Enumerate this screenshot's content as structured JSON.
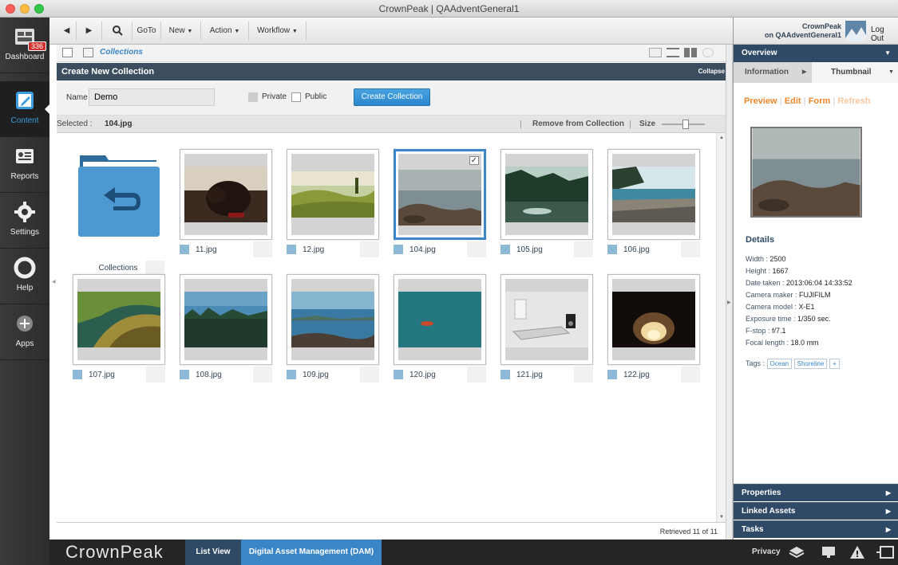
{
  "window": {
    "title": "CrownPeak | QAAdventGeneral1"
  },
  "leftnav": {
    "badge": "336",
    "items": [
      {
        "label": "Dashboard",
        "icon": "dashboard-icon"
      },
      {
        "label": "Content",
        "icon": "content-edit-icon"
      },
      {
        "label": "Reports",
        "icon": "reports-icon"
      },
      {
        "label": "Settings",
        "icon": "gear-icon"
      },
      {
        "label": "Help",
        "icon": "lifebuoy-icon"
      },
      {
        "label": "Apps",
        "icon": "plus-circle-icon"
      }
    ]
  },
  "toolbar": {
    "goto": "GoTo",
    "new": "New",
    "action": "Action",
    "workflow": "Workflow",
    "user_line1": "CrownPeak",
    "user_line2": "on QAAdventGeneral1",
    "logout": "Log Out"
  },
  "breadcrumb": {
    "label": "Collections"
  },
  "panel": {
    "title": "Create New Collection",
    "collapse": "Collapse",
    "name_label": "Name",
    "name_value": "Demo",
    "private_label": "Private",
    "public_label": "Public",
    "create_button": "Create Collection"
  },
  "selection": {
    "selected_label": "Selected :",
    "selected_value": "104.jpg",
    "remove": "Remove from Collection",
    "size_label": "Size",
    "size_level": 0.55
  },
  "grid": {
    "collections_label": "Collections",
    "items": [
      {
        "name": "11.jpg",
        "selected": false,
        "scene": "dog"
      },
      {
        "name": "12.jpg",
        "selected": false,
        "scene": "hills"
      },
      {
        "name": "104.jpg",
        "selected": true,
        "scene": "rocky-shore"
      },
      {
        "name": "105.jpg",
        "selected": false,
        "scene": "forest-lake"
      },
      {
        "name": "106.jpg",
        "selected": false,
        "scene": "beach"
      },
      {
        "name": "107.jpg",
        "selected": false,
        "scene": "tree"
      },
      {
        "name": "108.jpg",
        "selected": false,
        "scene": "lake-forest"
      },
      {
        "name": "109.jpg",
        "selected": false,
        "scene": "coast"
      },
      {
        "name": "120.jpg",
        "selected": false,
        "scene": "sea-boat"
      },
      {
        "name": "121.jpg",
        "selected": false,
        "scene": "desk"
      },
      {
        "name": "122.jpg",
        "selected": false,
        "scene": "cave"
      }
    ]
  },
  "status": {
    "retrieved": "Retrieved 11 of 11"
  },
  "rightpanel": {
    "overview": "Overview",
    "tab_information": "Information",
    "tab_thumbnail": "Thumbnail",
    "links": {
      "preview": "Preview",
      "edit": "Edit",
      "form": "Form",
      "refresh": "Refresh"
    },
    "details_title": "Details",
    "details": [
      {
        "label": "Width :",
        "value": "2500"
      },
      {
        "label": "Height :",
        "value": "1667"
      },
      {
        "label": "Date taken :",
        "value": "2013:06:04 14:33:52"
      },
      {
        "label": "Camera maker :",
        "value": "FUJIFILM"
      },
      {
        "label": "Camera model :",
        "value": "X-E1"
      },
      {
        "label": "Exposure time :",
        "value": "1/350 sec."
      },
      {
        "label": "F-stop :",
        "value": "f/7.1"
      },
      {
        "label": "Focal length :",
        "value": "18.0 mm"
      }
    ],
    "tags_label": "Tags :",
    "tags": [
      "Ocean",
      "Shoreline",
      "+"
    ],
    "sections": [
      "Properties",
      "Linked Assets",
      "Tasks"
    ]
  },
  "bottombar": {
    "brand": "CrownPeak",
    "list_view": "List View",
    "dam": "Digital Asset Management (DAM)",
    "privacy": "Privacy"
  },
  "colors": {
    "accent": "#3b86c8",
    "header": "#3b4d5e",
    "orange": "#f0872b",
    "section": "#2f4a66"
  }
}
